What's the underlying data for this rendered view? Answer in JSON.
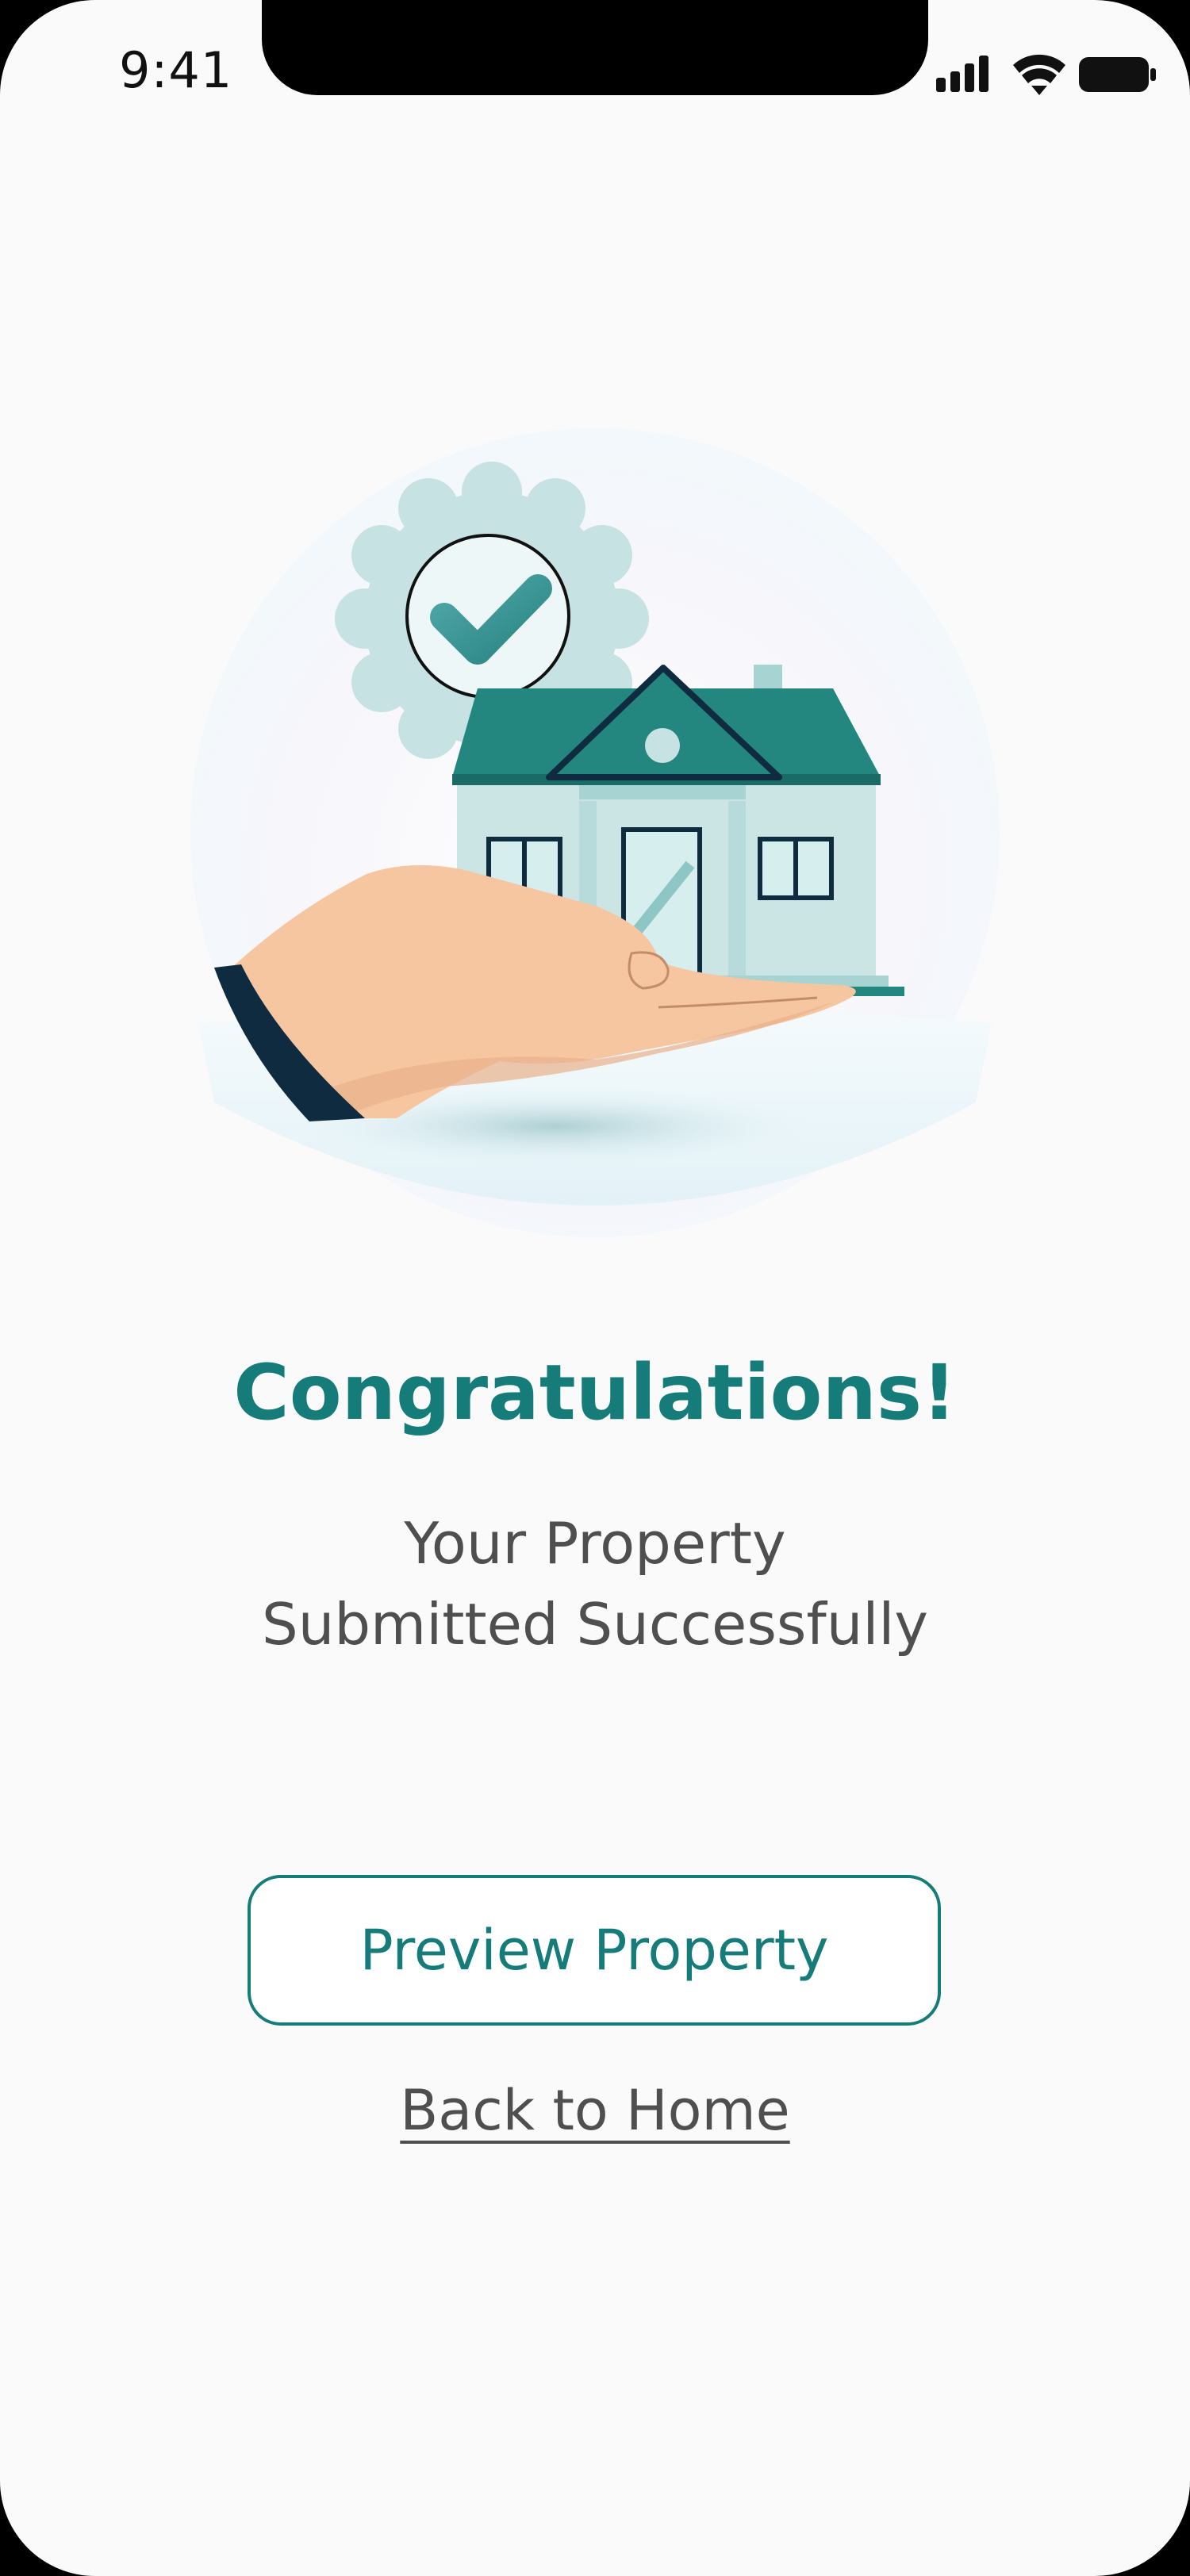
{
  "status_bar": {
    "time": "9:41",
    "icons": [
      "signal-icon",
      "wifi-icon",
      "battery-icon"
    ]
  },
  "illustration": {
    "name": "hand-holding-house-with-check-badge",
    "colors": {
      "teal": "#23877f",
      "skin": "#f6c6a0",
      "sleeve": "#0f2b40",
      "badge": "#c7e2e2"
    }
  },
  "main": {
    "title": "Congratulations!",
    "subtitle_line1": "Your Property",
    "subtitle_line2": "Submitted Successfully",
    "preview_button_label": "Preview Property",
    "back_home_link_label": "Back to Home"
  },
  "colors": {
    "accent": "#157c7a",
    "text": "#4f4f4f",
    "background": "#fafafa"
  }
}
